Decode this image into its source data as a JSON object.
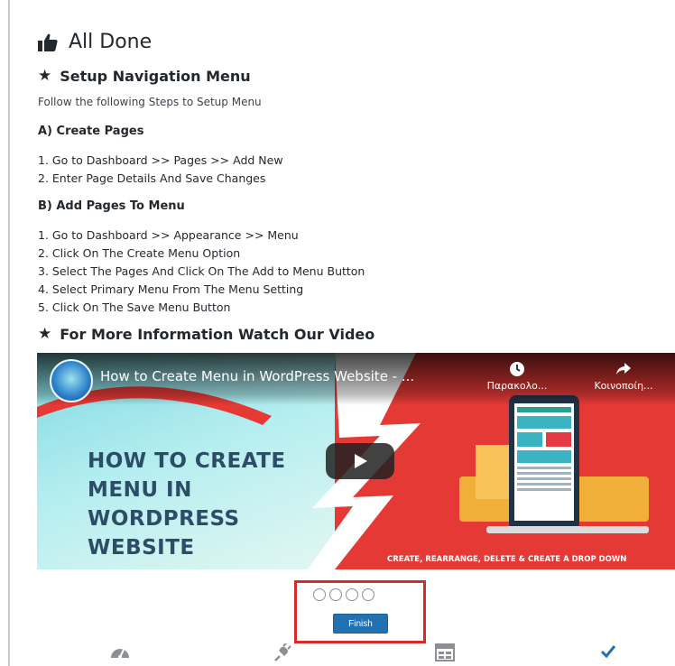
{
  "page": {
    "title": "All Done",
    "title_icon": "thumbs-up-icon"
  },
  "setup_menu": {
    "heading": "Setup Navigation Menu",
    "intro": "Follow the following Steps to Setup Menu",
    "sections": [
      {
        "heading": "A) Create Pages",
        "steps": [
          "1. Go to Dashboard >> Pages >> Add New",
          "2. Enter Page Details And Save Changes"
        ]
      },
      {
        "heading": "B) Add Pages To Menu",
        "steps": [
          "1. Go to Dashboard >> Appearance >> Menu",
          "2. Click On The Create Menu Option",
          "3. Select The Pages And Click On The Add to Menu Button",
          "4. Select Primary Menu From The Menu Setting",
          "5. Click On The Save Menu Button"
        ]
      }
    ]
  },
  "video_section": {
    "heading": "For More Information Watch Our Video",
    "video": {
      "title": "How to Create Menu in WordPress Website - ...",
      "watch_later_label": "Παρακολο...",
      "share_label": "Κοινοποίη...",
      "thumb_heading_lines": [
        "HOW TO CREATE",
        "MENU IN",
        "WORDPRESS",
        "WEBSITE"
      ],
      "thumb_footer": "CREATE, REARRANGE, DELETE & CREATE A DROP DOWN",
      "colors": {
        "red": "#e53935",
        "cyan": "#7fd9e0",
        "heading": "#2d4c68"
      }
    }
  },
  "wizard": {
    "finish_label": "Finish",
    "step_count": 4,
    "step_icons": [
      "dashboard-gauge-icon",
      "plugin-plug-icon",
      "layout-grid-icon",
      "checkmark-icon"
    ],
    "accent_color": "#2271b1",
    "highlight_color": "#d62a2a"
  }
}
